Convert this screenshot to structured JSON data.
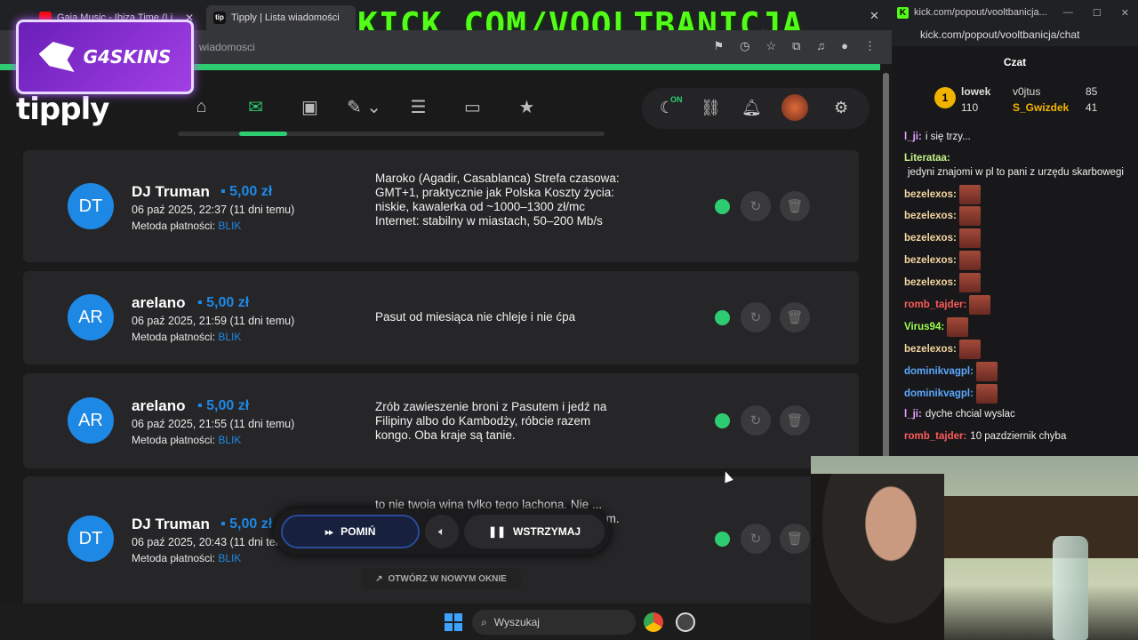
{
  "browser": {
    "tabs": [
      {
        "title": "Gaja Music - Ibiza Time (Li...",
        "favicon": "youtube-icon"
      },
      {
        "title": "Tipply | Lista wiadomości",
        "favicon": "tipply-icon"
      }
    ],
    "address_partial": "wiadomosci"
  },
  "banner": {
    "text": "KICK.COM/VOOLTBANICJA"
  },
  "sponsor": {
    "name": "G4SKINS"
  },
  "app": {
    "logo": "tipply",
    "nav_on_badge": "ON",
    "accent_color": "#2ecc71",
    "link_color": "#1e88e5"
  },
  "messages": [
    {
      "initials": "DT",
      "name": "DJ Truman",
      "amount": "5,00 zł",
      "date": "06 paź 2025, 22:37 (11 dni temu)",
      "method_label": "Metoda płatności:",
      "method": "BLIK",
      "text": "Maroko (Agadir, Casablanca) Strefa czasowa: GMT+1, praktycznie jak Polska Koszty życia: niskie, kawalerka od ~1000–1300 zł/mc Internet: stabilny w miastach, 50–200 Mb/s"
    },
    {
      "initials": "AR",
      "name": "arelano",
      "amount": "5,00 zł",
      "date": "06 paź 2025, 21:59 (11 dni temu)",
      "method_label": "Metoda płatności:",
      "method": "BLIK",
      "text": "Pasut od miesiąca nie chleje i nie ćpa"
    },
    {
      "initials": "AR",
      "name": "arelano",
      "amount": "5,00 zł",
      "date": "06 paź 2025, 21:55 (11 dni temu)",
      "method_label": "Metoda płatności:",
      "method": "BLIK",
      "text": "Zrób zawieszenie broni z Pasutem i jedź na Filipiny albo do Kambodży, róbcie razem kongo. Oba kraje są tanie."
    },
    {
      "initials": "DT",
      "name": "DJ Truman",
      "amount": "5,00 zł",
      "date": "06 paź 2025, 20:43 (11 dni temu)",
      "method_label": "Metoda płatności:",
      "method": "BLIK",
      "text": "to nie twoja wina tylko tego lachona. Nie ... muzyczkę i się ubierz bo mama myśli że ... m. kocham cb"
    }
  ],
  "player": {
    "skip": "POMIŃ",
    "pause": "WSTRZYMAJ",
    "open_new": "OTWÓRZ W NOWYM OKNIE"
  },
  "taskbar": {
    "search": "Wyszukaj"
  },
  "chat_window": {
    "tab_title": "kick.com/popout/vooltbanicja...",
    "address": "kick.com/popout/vooltbanicja/chat",
    "title": "Czat",
    "leaderboard": [
      {
        "rank": "1",
        "user": "lowek",
        "value": "110"
      },
      {
        "user": "v0jtus",
        "value": "85"
      },
      {
        "user": "S_Gwizdek",
        "value": "41"
      }
    ],
    "lines": [
      {
        "user": "l_ji:",
        "text": "i się trzy...",
        "color": "#e8a0ff",
        "emotes": 0
      },
      {
        "user": "Literataa:",
        "text": "jedyni znajomi w pl to pani z urzędu skarbowegi",
        "color": "#c6f28a",
        "emotes": 0
      },
      {
        "user": "bezelexos:",
        "text": "",
        "color": "#f5d6a0",
        "emotes": 1
      },
      {
        "user": "bezelexos:",
        "text": "",
        "color": "#f5d6a0",
        "emotes": 1
      },
      {
        "user": "bezelexos:",
        "text": "",
        "color": "#f5d6a0",
        "emotes": 1
      },
      {
        "user": "bezelexos:",
        "text": "",
        "color": "#f5d6a0",
        "emotes": 1
      },
      {
        "user": "bezelexos:",
        "text": "",
        "color": "#f5d6a0",
        "emotes": 1
      },
      {
        "user": "romb_tajder:",
        "text": "",
        "color": "#ff5b5b",
        "emotes": 1
      },
      {
        "user": "Virus94:",
        "text": "",
        "color": "#9cff4f",
        "emotes": 1
      },
      {
        "user": "bezelexos:",
        "text": "",
        "color": "#f5d6a0",
        "emotes": 1
      },
      {
        "user": "dominikvagpl:",
        "text": "",
        "color": "#5aa8ff",
        "emotes": 1
      },
      {
        "user": "dominikvagpl:",
        "text": "",
        "color": "#5aa8ff",
        "emotes": 1
      },
      {
        "user": "l_ji:",
        "text": "dyche chcial wyslac",
        "color": "#e8a0ff",
        "emotes": 0
      },
      {
        "user": "romb_tajder:",
        "text": "10 pazdziernik chyba",
        "color": "#ff5b5b",
        "emotes": 0
      }
    ]
  }
}
